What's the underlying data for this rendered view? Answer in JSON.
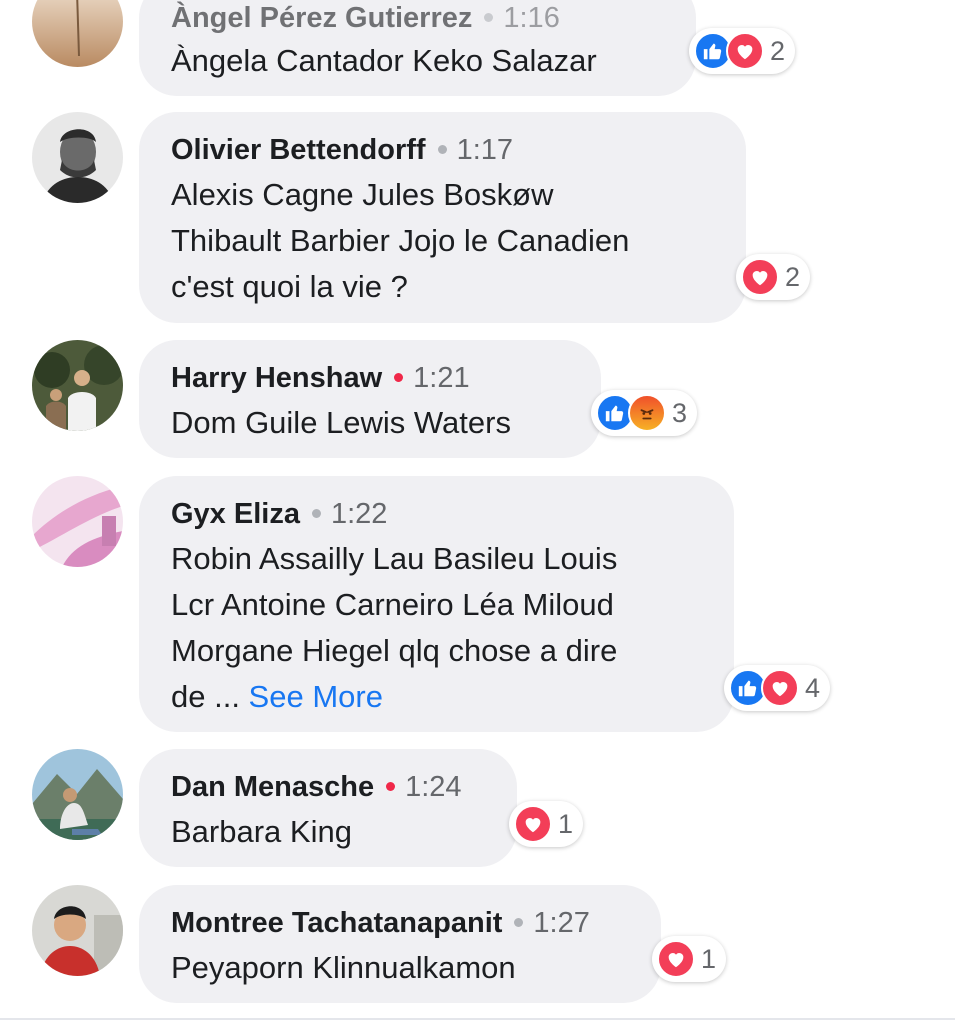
{
  "comments": [
    {
      "author": "Àngel Pérez Gutierrez",
      "time": "1:16",
      "online": false,
      "lines": [
        "Àngela Cantador Keko Salazar"
      ],
      "reactions": [
        "like",
        "love"
      ],
      "count": "2"
    },
    {
      "author": "Olivier Bettendorff",
      "time": "1:17",
      "online": false,
      "lines": [
        "Alexis Cagne Jules Boskøw",
        "Thibault Barbier Jojo le Canadien",
        "c'est quoi la vie ?"
      ],
      "reactions": [
        "love"
      ],
      "count": "2"
    },
    {
      "author": "Harry Henshaw",
      "time": "1:21",
      "online": true,
      "lines": [
        "Dom Guile Lewis Waters"
      ],
      "reactions": [
        "like",
        "angry"
      ],
      "count": "3"
    },
    {
      "author": "Gyx Eliza",
      "time": "1:22",
      "online": false,
      "lines": [
        "Robin Assailly Lau Basileu Louis",
        "Lcr Antoine Carneiro Léa Miloud",
        "Morgane Hiegel qlq chose a dire"
      ],
      "last_line_prefix": "de ... ",
      "see_more": "See More",
      "reactions": [
        "like",
        "love"
      ],
      "count": "4"
    },
    {
      "author": "Dan Menasche",
      "time": "1:24",
      "online": true,
      "lines": [
        "Barbara King"
      ],
      "reactions": [
        "love"
      ],
      "count": "1"
    },
    {
      "author": "Montree Tachatanapanit",
      "time": "1:27",
      "online": false,
      "lines": [
        "Peyaporn Klinnualkamon"
      ],
      "reactions": [
        "love"
      ],
      "count": "1"
    }
  ],
  "colors": {
    "like": "#1877f2",
    "love": "#f33e58",
    "angry": "#f7b125",
    "online": "#f02849",
    "link": "#1877f2"
  }
}
